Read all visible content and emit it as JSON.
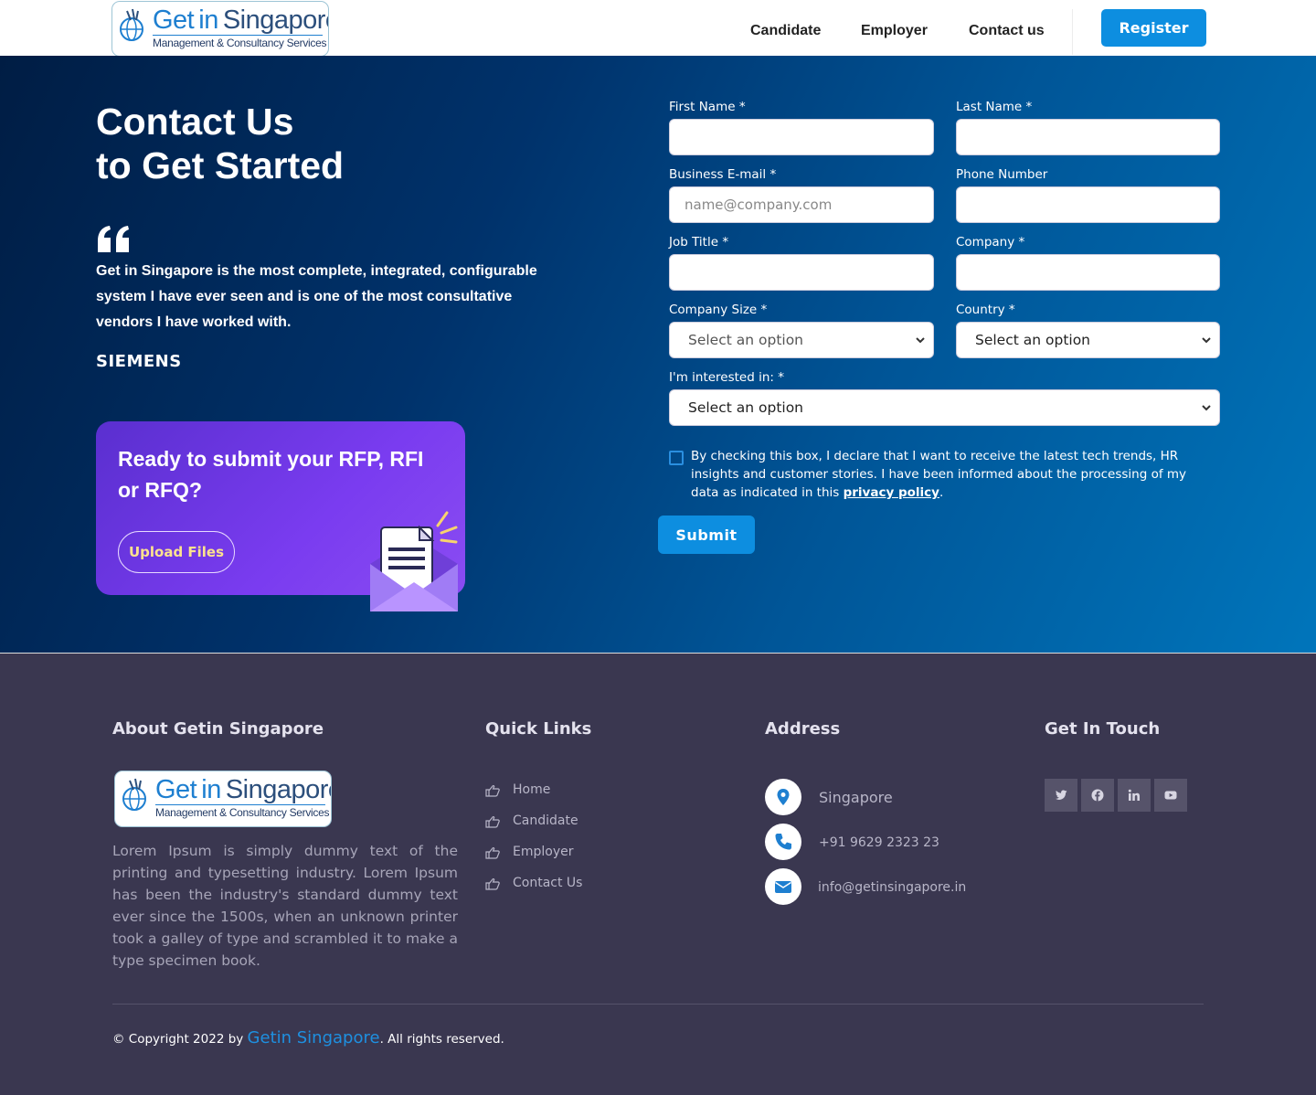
{
  "header": {
    "logo": {
      "word1": "Get",
      "word2": "in",
      "word3": "Singapore",
      "tagline": "Management & Consultancy Services"
    },
    "nav": [
      "Candidate",
      "Employer",
      "Contact us"
    ],
    "register_label": "Register"
  },
  "hero": {
    "title_line1": "Contact Us",
    "title_line2": "to Get Started",
    "quote": "Get in Singapore is the most complete, integrated, configurable system I have ever seen and is one of the most consultative vendors I have worked with.",
    "quote_author": "SIEMENS",
    "rfp": {
      "title": "Ready to submit your RFP, RFI or RFQ?",
      "upload_label": "Upload Files"
    }
  },
  "form": {
    "first_name_label": "First Name *",
    "last_name_label": "Last Name *",
    "email_label": "Business E-mail *",
    "email_placeholder": "name@company.com",
    "phone_label": "Phone Number",
    "job_title_label": "Job Title *",
    "company_label": "Company *",
    "company_size_label": "Company Size *",
    "company_size_value": "Select an option",
    "country_label": "Country *",
    "country_value": "Select an option",
    "interest_label": "I'm interested in: *",
    "interest_value": "Select an option",
    "consent_text": "By checking this box, I declare that I want to receive the latest tech trends, HR insights and customer stories. I have been informed about the processing of my data as indicated in this ",
    "consent_link": "privacy policy",
    "consent_end": ".",
    "submit_label": "Submit"
  },
  "footer": {
    "about_heading": "About Getin Singapore",
    "about_text": "Lorem Ipsum is simply dummy text of the printing and typesetting industry. Lorem Ipsum has been the industry's standard dummy text ever since the 1500s, when an unknown printer took a galley of type and scrambled it to make a type specimen book.",
    "quick_links_heading": "Quick Links",
    "quick_links": [
      "Home",
      "Candidate",
      "Employer",
      "Contact Us"
    ],
    "address_heading": "Address",
    "address": {
      "location": "Singapore",
      "phone": "+91 9629 2323 23",
      "email": "info@getinsingapore.in"
    },
    "touch_heading": "Get In Touch",
    "social_icons": [
      "twitter-icon",
      "facebook-icon",
      "linkedin-icon",
      "youtube-icon"
    ],
    "copyright_prefix": "© Copyright 2022 by ",
    "copyright_brand": "Getin Singapore",
    "copyright_suffix": ". All rights reserved."
  },
  "colors": {
    "accent": "#0d8ee0",
    "footer_bg": "#3a3750",
    "rfp_purple": "#7a3cf0"
  }
}
